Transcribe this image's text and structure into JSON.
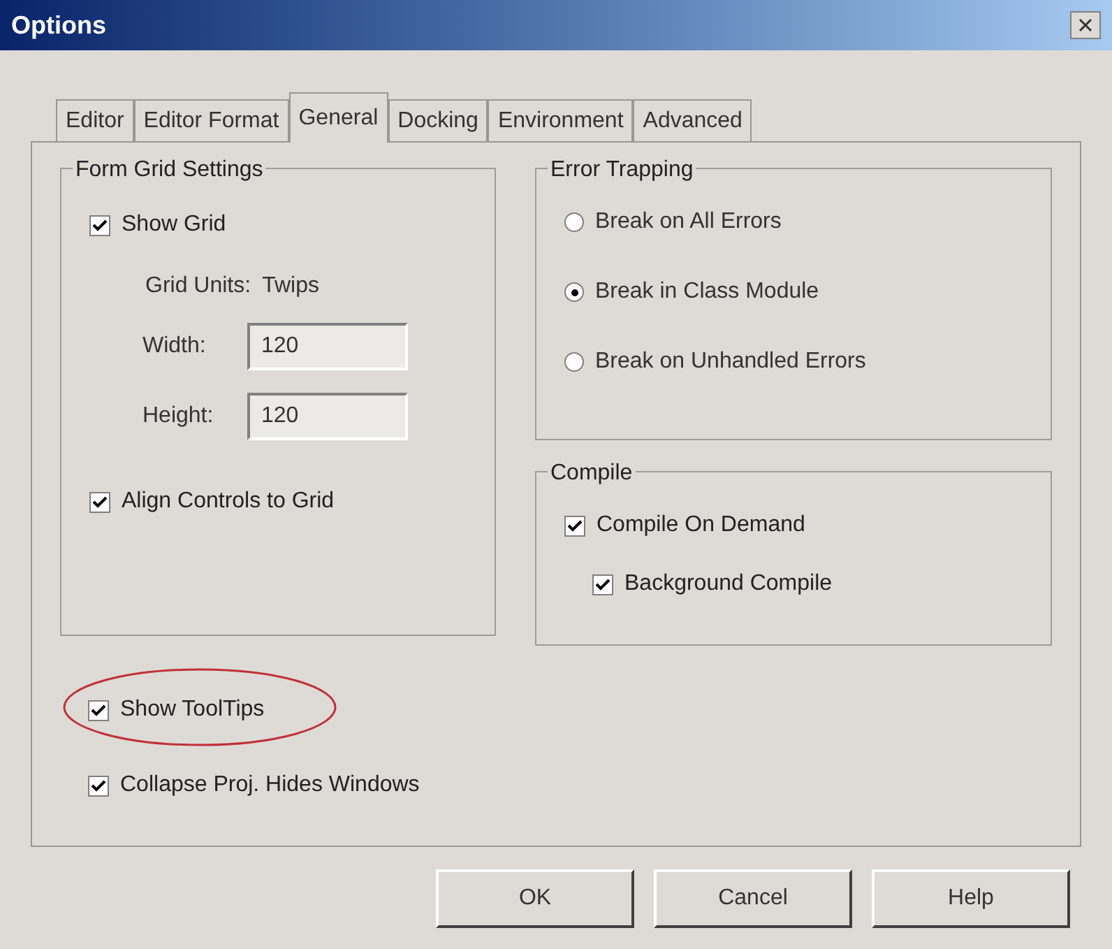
{
  "window": {
    "title": "Options"
  },
  "tabs": [
    {
      "label": "Editor",
      "selected": false
    },
    {
      "label": "Editor Format",
      "selected": false
    },
    {
      "label": "General",
      "selected": true
    },
    {
      "label": "Docking",
      "selected": false
    },
    {
      "label": "Environment",
      "selected": false
    },
    {
      "label": "Advanced",
      "selected": false
    }
  ],
  "form_grid": {
    "title": "Form Grid Settings",
    "show_grid": {
      "label": "Show Grid",
      "checked": true
    },
    "grid_units": {
      "label": "Grid Units:",
      "value": "Twips"
    },
    "fields": [
      {
        "label": "Width:",
        "value": "120"
      },
      {
        "label": "Height:",
        "value": "120"
      }
    ],
    "align": {
      "label": "Align Controls to Grid",
      "checked": true
    }
  },
  "error_trapping": {
    "title": "Error Trapping",
    "options": [
      {
        "label": "Break on All Errors",
        "selected": false
      },
      {
        "label": "Break in Class Module",
        "selected": true
      },
      {
        "label": "Break on Unhandled Errors",
        "selected": false
      }
    ]
  },
  "compile": {
    "title": "Compile",
    "items": [
      {
        "label": "Compile On Demand",
        "checked": true,
        "children": [
          {
            "label": "Background Compile",
            "checked": true
          }
        ]
      }
    ]
  },
  "checkboxes": [
    {
      "label": "Show ToolTips",
      "checked": true,
      "circled": true
    },
    {
      "label": "Collapse Proj. Hides Windows",
      "checked": true,
      "circled": false
    }
  ],
  "buttons": [
    "OK",
    "Cancel",
    "Help"
  ]
}
